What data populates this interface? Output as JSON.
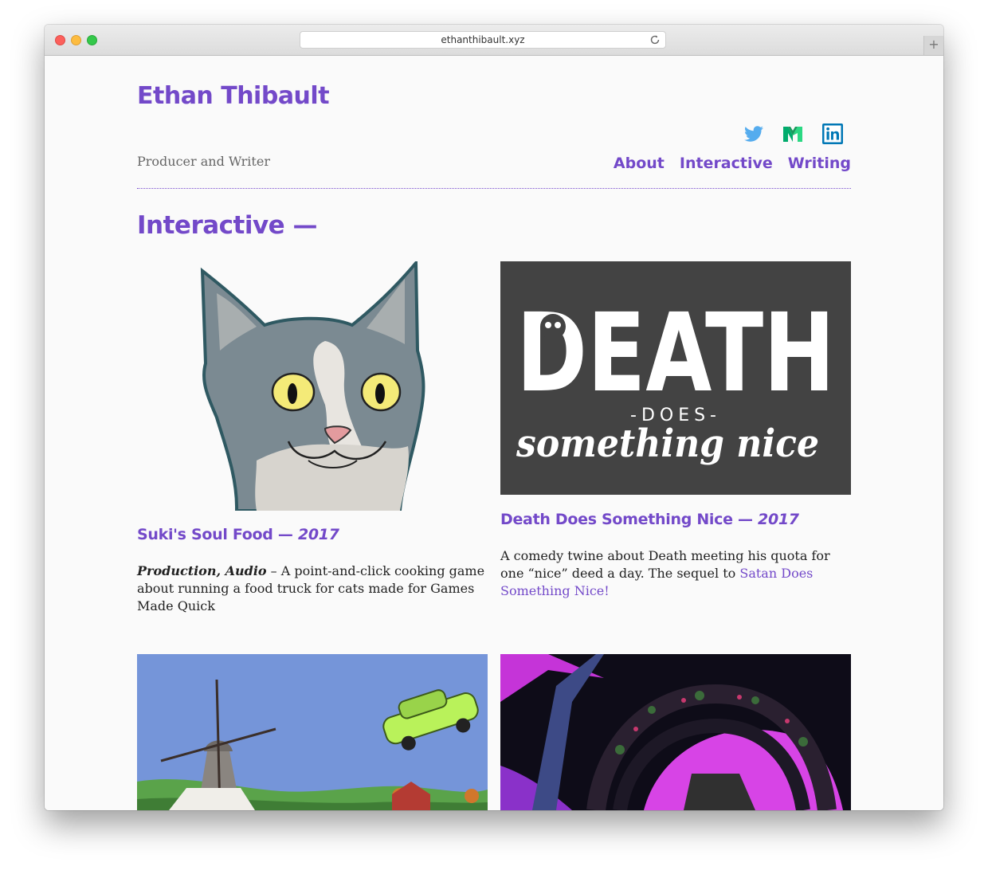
{
  "browser": {
    "url": "ethanthibault.xyz",
    "new_tab_label": "+"
  },
  "header": {
    "site_title": "Ethan Thibault",
    "tagline": "Producer and Writer",
    "social": [
      "twitter-icon",
      "medium-icon",
      "linkedin-icon"
    ],
    "nav": [
      "About",
      "Interactive",
      "Writing"
    ]
  },
  "section": {
    "heading": "Interactive —"
  },
  "projects": [
    {
      "title": "Suki's Soul Food",
      "separator": " — ",
      "year": "2017",
      "role": "Production, Audio",
      "description": " – A point-and-click cooking game about running a food truck for cats made for Games Made Quick"
    },
    {
      "title": "Death Does Something Nice",
      "separator": " — ",
      "year": "2017",
      "description": "A comedy twine about Death meeting his quota for one “nice” deed a day. The sequel to ",
      "link_text": "Satan Does Something Nice!",
      "image_text": {
        "word1": "DEATH",
        "word2": "-DOES-",
        "word3": "something nice"
      }
    }
  ],
  "colors": {
    "accent": "#7349c9",
    "twitter": "#55acee",
    "medium": "#00ab6c",
    "linkedin": "#0077b5",
    "death_bg": "#434343"
  }
}
